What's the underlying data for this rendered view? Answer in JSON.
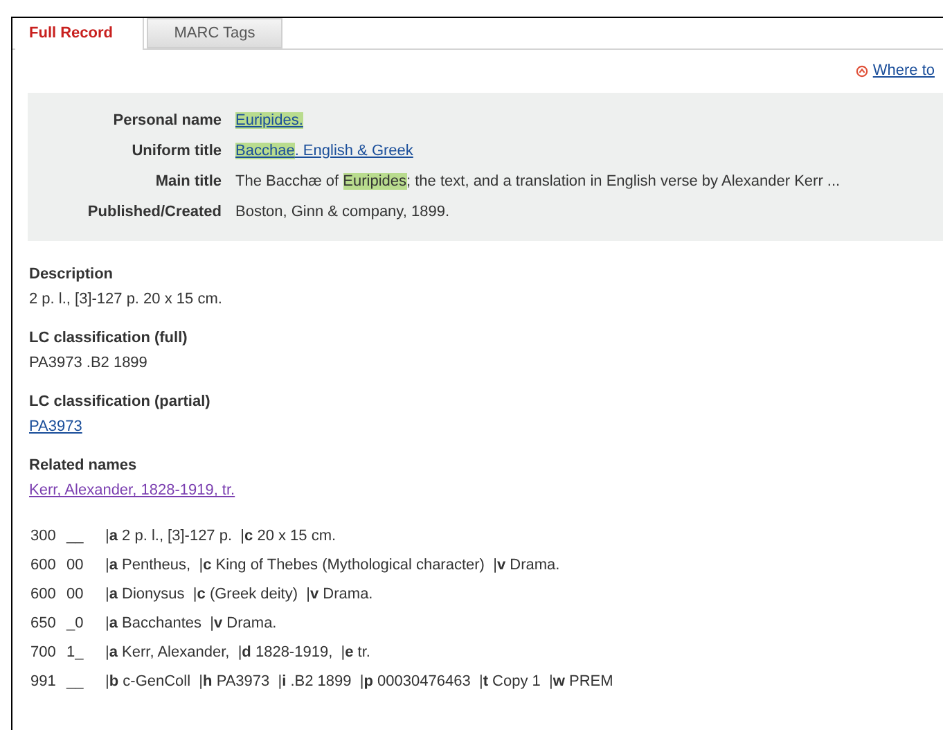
{
  "tabs": [
    {
      "label": "Full Record",
      "selected": true
    },
    {
      "label": "MARC Tags",
      "selected": false
    }
  ],
  "where_link": "Where to",
  "summary": [
    {
      "label": "Personal name",
      "kind": "link",
      "segments": [
        {
          "text": "Euripides.",
          "highlighted": true
        }
      ]
    },
    {
      "label": "Uniform title",
      "kind": "link",
      "segments": [
        {
          "text": "Bacchae",
          "highlighted": true
        },
        {
          "text": ". English & Greek",
          "highlighted": false
        }
      ]
    },
    {
      "label": "Main title",
      "kind": "text",
      "segments": [
        {
          "text": "The Bacchæ of ",
          "highlighted": false
        },
        {
          "text": "Euripides",
          "highlighted": true
        },
        {
          "text": "; the text, and a translation in English verse by Alexander Kerr ...",
          "highlighted": false
        }
      ]
    },
    {
      "label": "Published/Created",
      "kind": "text",
      "segments": [
        {
          "text": "Boston, Ginn & company, 1899.",
          "highlighted": false
        }
      ]
    }
  ],
  "fields": [
    {
      "heading": "Description",
      "value": "2 p. l., [3]-127 p. 20 x 15 cm.",
      "kind": "text"
    },
    {
      "heading": "LC classification (full)",
      "value": "PA3973 .B2 1899",
      "kind": "text"
    },
    {
      "heading": "LC classification (partial)",
      "value": "PA3973",
      "kind": "link"
    },
    {
      "heading": "Related names",
      "value": "Kerr, Alexander, 1828-1919, tr.",
      "kind": "visited-link"
    }
  ],
  "marc": [
    {
      "tag": "300",
      "indicators": "__",
      "subfields": "|**a** 2 p. l., [3]-127 p.  |**c** 20 x 15 cm."
    },
    {
      "tag": "600",
      "indicators": "00",
      "subfields": "|**a** Pentheus,  |**c** King of Thebes (Mythological character)  |**v** Drama."
    },
    {
      "tag": "600",
      "indicators": "00",
      "subfields": "|**a** Dionysus  |**c** (Greek deity)  |**v** Drama."
    },
    {
      "tag": "650",
      "indicators": "_0",
      "subfields": "|**a** Bacchantes  |**v** Drama."
    },
    {
      "tag": "700",
      "indicators": "1_",
      "subfields": "|**a** Kerr, Alexander,  |**d** 1828-1919,  |**e** tr."
    },
    {
      "tag": "991",
      "indicators": "__",
      "subfields": "|**b** c-GenColl  |**h** PA3973  |**i** .B2 1899  |**p** 00030476463  |**t** Copy 1  |**w** PREM"
    }
  ]
}
